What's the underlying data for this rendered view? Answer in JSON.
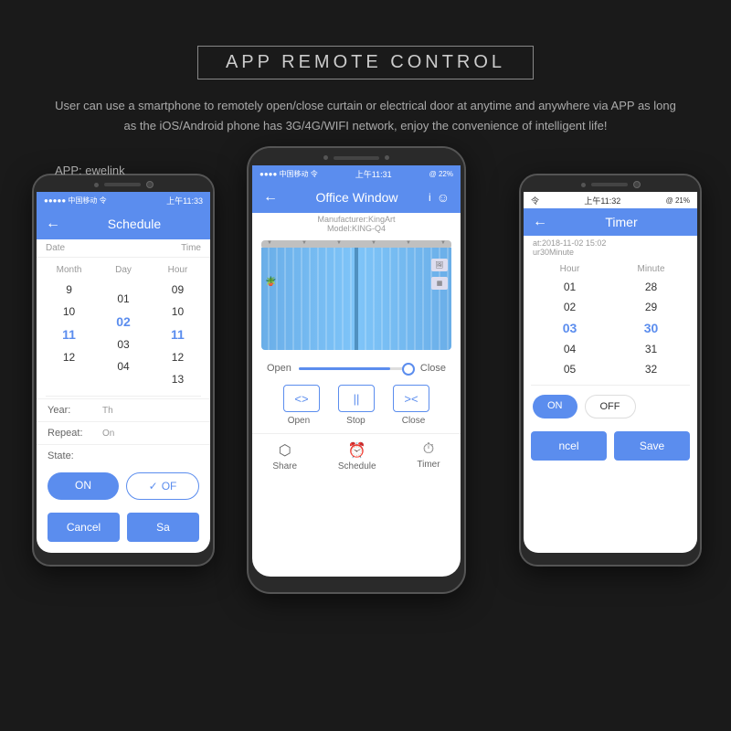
{
  "header": {
    "title": "APP REMOTE CONTROL",
    "description": "User can use a smartphone to remotely open/close curtain or electrical door at anytime and anywhere via APP as long as the iOS/Android phone has 3G/4G/WIFI network, enjoy the convenience of intelligent life!",
    "app_label": "APP: ewelink"
  },
  "phone_left": {
    "status": "●●●●● 中国移动 令",
    "time": "上午11:33",
    "screen_title": "Schedule",
    "date_label": "Date",
    "time_col_label": "Time",
    "month_label": "Month",
    "day_label": "Day",
    "hour_label": "Hour",
    "rows": [
      {
        "month": "9",
        "day": "",
        "hour": "09"
      },
      {
        "month": "10",
        "day": "01",
        "hour": "10"
      },
      {
        "month": "11",
        "day": "02",
        "hour": "11",
        "selected": true
      },
      {
        "month": "12",
        "day": "03",
        "hour": "12"
      },
      {
        "month": "",
        "day": "04",
        "hour": "13"
      }
    ],
    "year_label": "Year:",
    "year_value": "Th",
    "repeat_label": "Repeat:",
    "repeat_value": "On",
    "state_label": "State:",
    "on_label": "ON",
    "off_label": "OF",
    "cancel_label": "Cancel",
    "save_label": "Sa"
  },
  "phone_center": {
    "status": "●●●● 中国移动 令",
    "time": "上午11:31",
    "battery": "@ 22%",
    "screen_title": "Office Window",
    "info_icon": "i",
    "smile_icon": "☺",
    "manufacturer": "Manufacturer:KingArt",
    "model": "Model:KING-Q4",
    "slider_left": "Open",
    "slider_right": "Close",
    "open_label": "Open",
    "stop_label": "Stop",
    "close_label": "Close",
    "nav": [
      {
        "icon": "⬡",
        "label": "Share"
      },
      {
        "icon": "◷",
        "label": "Schedule"
      },
      {
        "icon": "◷",
        "label": "Timer"
      }
    ]
  },
  "phone_right": {
    "status": "令",
    "time": "上午11:32",
    "battery": "@ 21%",
    "screen_title": "Timer",
    "info1": "at:2018-11-02 15:02",
    "info2": "ur30Minute",
    "hour_label": "Hour",
    "minute_label": "Minute",
    "rows": [
      {
        "hour": "01",
        "minute": "28"
      },
      {
        "hour": "02",
        "minute": "29"
      },
      {
        "hour": "03",
        "minute": "30",
        "selected": true
      },
      {
        "hour": "04",
        "minute": "31"
      },
      {
        "hour": "05",
        "minute": "32"
      }
    ],
    "on_label": "ON",
    "off_label": "OFF",
    "cancel_label": "ncel",
    "save_label": "Save"
  }
}
